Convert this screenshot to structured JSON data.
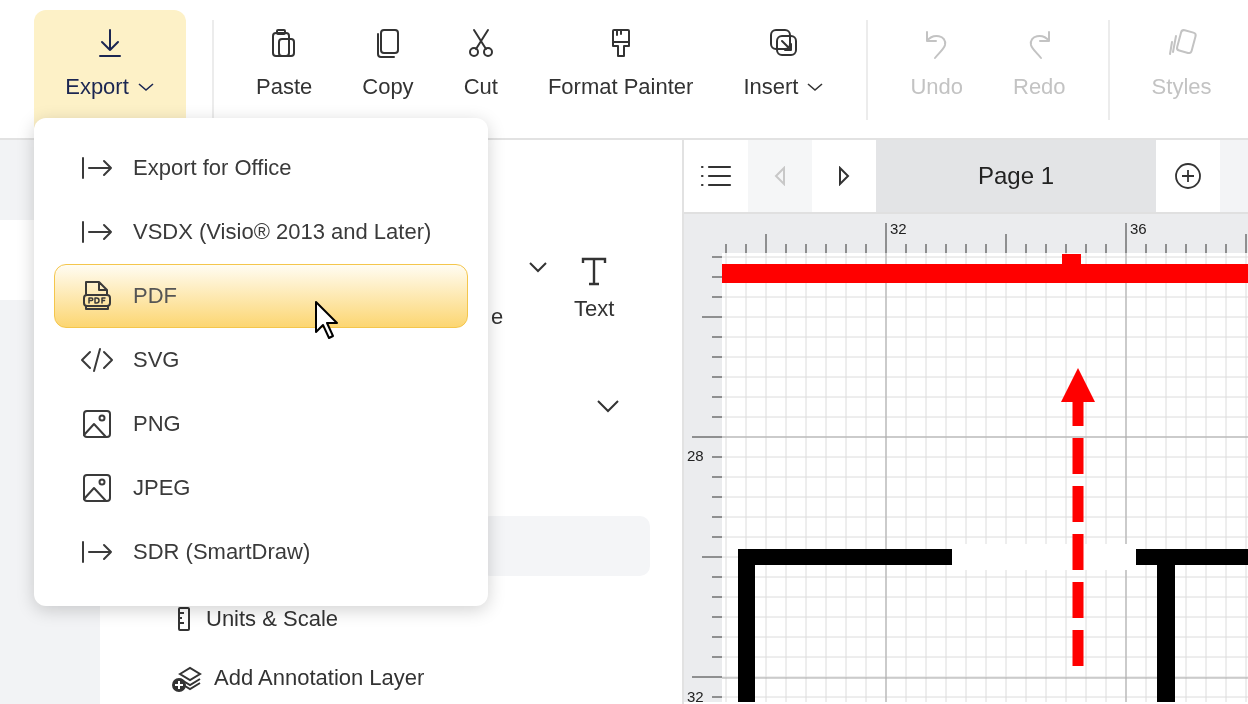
{
  "toolbar": {
    "groups": [
      [
        {
          "label": "Export",
          "dropdown": true,
          "expanded": true,
          "disabled": false
        }
      ],
      [
        {
          "label": "Paste",
          "dropdown": false,
          "expanded": false,
          "disabled": false
        },
        {
          "label": "Copy",
          "dropdown": false,
          "expanded": false,
          "disabled": false
        },
        {
          "label": "Cut",
          "dropdown": false,
          "expanded": false,
          "disabled": false
        },
        {
          "label": "Format Painter",
          "dropdown": false,
          "expanded": false,
          "disabled": false
        },
        {
          "label": "Insert",
          "dropdown": true,
          "expanded": false,
          "disabled": false
        }
      ],
      [
        {
          "label": "Undo",
          "dropdown": false,
          "expanded": false,
          "disabled": true
        },
        {
          "label": "Redo",
          "dropdown": false,
          "expanded": false,
          "disabled": true
        }
      ],
      [
        {
          "label": "Styles",
          "dropdown": false,
          "expanded": false,
          "disabled": true
        }
      ]
    ]
  },
  "export_menu": {
    "items": [
      {
        "label": "Export for Office",
        "selected": false
      },
      {
        "label": "VSDX (Visio® 2013 and Later)",
        "selected": false
      },
      {
        "label": "PDF",
        "selected": true
      },
      {
        "label": "SVG",
        "selected": false
      },
      {
        "label": "PNG",
        "selected": false
      },
      {
        "label": "JPEG",
        "selected": false
      },
      {
        "label": "SDR (SmartDraw)",
        "selected": false
      }
    ]
  },
  "panel": {
    "partial_label": "e",
    "text_tool": "Text",
    "items": [
      {
        "label": "Units & Scale"
      },
      {
        "label": "Add Annotation Layer"
      }
    ]
  },
  "page_bar": {
    "prev_disabled": true,
    "next_disabled": false,
    "page_tab": "Page 1"
  },
  "rulers": {
    "top_labels": [
      "32",
      "36"
    ],
    "left_labels": [
      "28",
      "32"
    ]
  }
}
